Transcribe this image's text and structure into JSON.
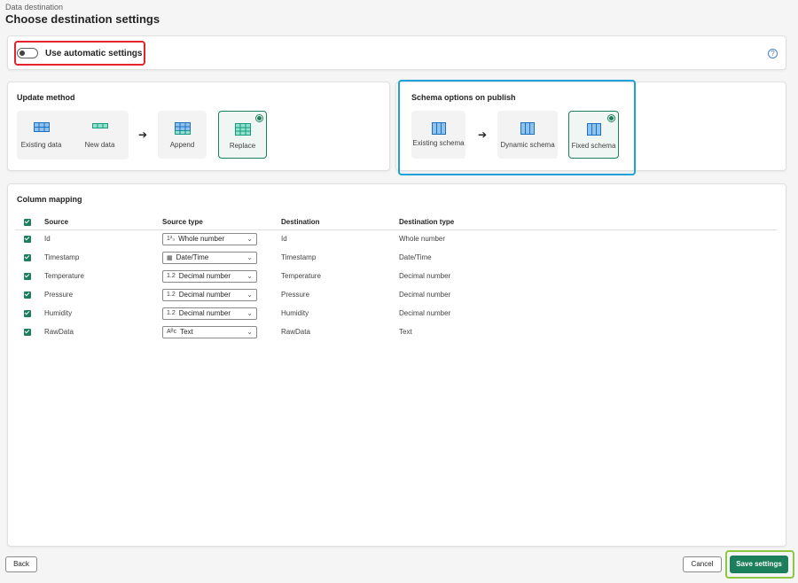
{
  "header": {
    "breadcrumb": "Data destination",
    "title": "Choose destination settings"
  },
  "auto_settings": {
    "label": "Use automatic settings",
    "enabled": false,
    "help_icon": "question-circle-icon"
  },
  "update_method": {
    "title": "Update method",
    "source_options": [
      "Existing data",
      "New data"
    ],
    "options": [
      "Append",
      "Replace"
    ],
    "selected": "Replace"
  },
  "schema_options": {
    "title": "Schema options on publish",
    "source_option": "Existing schema",
    "options": [
      "Dynamic schema",
      "Fixed schema"
    ],
    "selected": "Fixed schema"
  },
  "column_mapping": {
    "title": "Column mapping",
    "headers": [
      "Source",
      "Source type",
      "Destination",
      "Destination type"
    ],
    "rows": [
      {
        "source": "Id",
        "type_icon": "1²₃",
        "source_type": "Whole number",
        "destination": "Id",
        "destination_type": "Whole number"
      },
      {
        "source": "Timestamp",
        "type_icon": "calendar-icon",
        "source_type": "Date/Time",
        "destination": "Timestamp",
        "destination_type": "Date/Time"
      },
      {
        "source": "Temperature",
        "type_icon": "1.2",
        "source_type": "Decimal number",
        "destination": "Temperature",
        "destination_type": "Decimal number"
      },
      {
        "source": "Pressure",
        "type_icon": "1.2",
        "source_type": "Decimal number",
        "destination": "Pressure",
        "destination_type": "Decimal number"
      },
      {
        "source": "Humidity",
        "type_icon": "1.2",
        "source_type": "Decimal number",
        "destination": "Humidity",
        "destination_type": "Decimal number"
      },
      {
        "source": "RawData",
        "type_icon": "A^B_C",
        "source_type": "Text",
        "destination": "RawData",
        "destination_type": "Text"
      }
    ]
  },
  "footer": {
    "back": "Back",
    "cancel": "Cancel",
    "save": "Save settings"
  },
  "colors": {
    "accent": "#1a7f5a",
    "auto_highlight": "#e3242b",
    "schema_highlight": "#1ea0d8",
    "save_highlight": "#8dc63f"
  }
}
